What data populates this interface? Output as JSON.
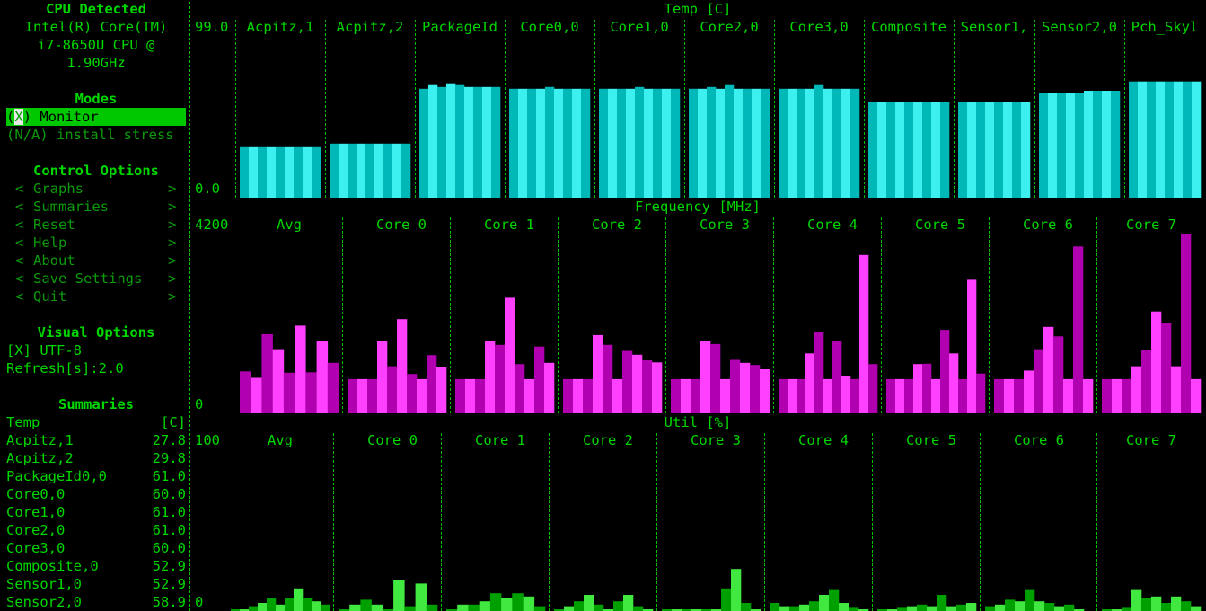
{
  "sidebar": {
    "cpu_title": "CPU Detected",
    "cpu_lines": [
      "Intel(R) Core(TM)",
      "i7-8650U CPU @",
      "1.90GHz"
    ],
    "modes_title": "Modes",
    "mode_monitor": {
      "open": "(",
      "mark": "X",
      "close": ") Monitor"
    },
    "mode_stress": "(N/A) install stress",
    "control_title": "Control Options",
    "controls": [
      {
        "label": "Graphs"
      },
      {
        "label": "Summaries"
      },
      {
        "label": "Reset"
      },
      {
        "label": "Help"
      },
      {
        "label": "About"
      },
      {
        "label": "Save Settings"
      },
      {
        "label": "Quit"
      }
    ],
    "bracket_left": "<",
    "bracket_right": ">",
    "visual_title": "Visual Options",
    "utf8_option": "[X] UTF-8",
    "refresh_option": "Refresh[s]:2.0",
    "summaries_title": "Summaries",
    "summary_header": {
      "name": "Temp",
      "unit": "[C]"
    },
    "summary_rows": [
      {
        "name": "Acpitz,1",
        "value": "27.8"
      },
      {
        "name": "Acpitz,2",
        "value": "29.8"
      },
      {
        "name": "PackageId0,0",
        "value": "61.0"
      },
      {
        "name": "Core0,0",
        "value": "60.0"
      },
      {
        "name": "Core1,0",
        "value": "61.0"
      },
      {
        "name": "Core2,0",
        "value": "61.0"
      },
      {
        "name": "Core3,0",
        "value": "60.0"
      },
      {
        "name": "Composite,0",
        "value": "52.9"
      },
      {
        "name": "Sensor1,0",
        "value": "52.9"
      },
      {
        "name": "Sensor2,0",
        "value": "58.9"
      }
    ]
  },
  "graphs": {
    "temp": {
      "title": "Temp [C]",
      "y_max": "99.0",
      "y_min": "0.0",
      "columns": [
        "Acpitz,1",
        "Acpitz,2",
        "PackageId",
        "Core0,0",
        "Core1,0",
        "Core2,0",
        "Core3,0",
        "Composite",
        "Sensor1,",
        "Sensor2,0",
        "Pch_Skyl"
      ]
    },
    "freq": {
      "title": "Frequency [MHz]",
      "y_max": "4200",
      "y_min": "0",
      "columns": [
        "Avg",
        "Core 0",
        "Core 1",
        "Core 2",
        "Core 3",
        "Core 4",
        "Core 5",
        "Core 6",
        "Core 7"
      ]
    },
    "util": {
      "title": "Util [%]",
      "y_max": "100",
      "y_min": "0",
      "columns": [
        "Avg",
        "Core 0",
        "Core 1",
        "Core 2",
        "Core 3",
        "Core 4",
        "Core 5",
        "Core 6",
        "Core 7"
      ]
    }
  },
  "chart_data": [
    {
      "type": "bar",
      "title": "Temp [C]",
      "ylabel": "Temp [C]",
      "ylim": [
        0,
        99
      ],
      "colors": [
        "#00b8b8",
        "#3cf0f0"
      ],
      "series": [
        {
          "name": "Acpitz,1",
          "values": [
            27.8,
            27.8,
            27.8,
            27.8,
            27.8,
            27.8,
            27.8,
            27.8,
            27.8
          ]
        },
        {
          "name": "Acpitz,2",
          "values": [
            29.8,
            29.8,
            29.8,
            29.8,
            29.8,
            29.8,
            29.8,
            29.8,
            29.8
          ]
        },
        {
          "name": "PackageId",
          "values": [
            60,
            62,
            61,
            63,
            62,
            61,
            61,
            61,
            61
          ]
        },
        {
          "name": "Core0,0",
          "values": [
            60,
            60,
            60,
            60,
            61,
            60,
            60,
            60,
            60
          ]
        },
        {
          "name": "Core1,0",
          "values": [
            60,
            60,
            60,
            60,
            61,
            60,
            60,
            60,
            60
          ]
        },
        {
          "name": "Core2,0",
          "values": [
            60,
            60,
            61,
            60,
            62,
            60,
            60,
            60,
            60
          ]
        },
        {
          "name": "Core3,0",
          "values": [
            60,
            60,
            60,
            60,
            62,
            60,
            60,
            60,
            60
          ]
        },
        {
          "name": "Composite",
          "values": [
            52.9,
            52.9,
            52.9,
            52.9,
            52.9,
            52.9,
            52.9,
            52.9,
            52.9
          ]
        },
        {
          "name": "Sensor1,",
          "values": [
            52.9,
            52.9,
            52.9,
            52.9,
            52.9,
            52.9,
            52.9,
            52.9
          ]
        },
        {
          "name": "Sensor2,0",
          "values": [
            57.9,
            57.9,
            57.9,
            57.9,
            57.9,
            58.9,
            58.9,
            58.9,
            58.9
          ]
        },
        {
          "name": "Pch_Skyl",
          "values": [
            64,
            64,
            64,
            64,
            64,
            64,
            64,
            64
          ]
        }
      ]
    },
    {
      "type": "bar",
      "title": "Frequency [MHz]",
      "ylabel": "Frequency [MHz]",
      "ylim": [
        0,
        4200
      ],
      "colors": [
        "#b000b0",
        "#ff40ff"
      ],
      "series": [
        {
          "name": "Avg",
          "values": [
            980,
            830,
            1850,
            1500,
            950,
            2050,
            960,
            1700,
            1180
          ]
        },
        {
          "name": "Core 0",
          "values": [
            800,
            800,
            800,
            1700,
            1100,
            2200,
            920,
            800,
            1360,
            1080
          ]
        },
        {
          "name": "Core 1",
          "values": [
            800,
            800,
            800,
            1700,
            1600,
            2700,
            1150,
            800,
            1560,
            1180
          ]
        },
        {
          "name": "Core 2",
          "values": [
            800,
            800,
            800,
            1830,
            1600,
            800,
            1460,
            1370,
            1240,
            1190
          ]
        },
        {
          "name": "Core 3",
          "values": [
            800,
            800,
            800,
            1700,
            1620,
            800,
            1250,
            1180,
            1130,
            1030
          ]
        },
        {
          "name": "Core 4",
          "values": [
            800,
            800,
            800,
            1400,
            1900,
            800,
            1700,
            870,
            800,
            3700,
            1150
          ]
        },
        {
          "name": "Core 5",
          "values": [
            800,
            800,
            800,
            1150,
            1160,
            800,
            1950,
            1400,
            800,
            3120,
            930
          ]
        },
        {
          "name": "Core 6",
          "values": [
            800,
            800,
            800,
            1000,
            1500,
            2020,
            1800,
            800,
            3900,
            800
          ]
        },
        {
          "name": "Core 7",
          "values": [
            800,
            800,
            800,
            1100,
            1470,
            2380,
            2120,
            1100,
            4200,
            800
          ]
        }
      ]
    },
    {
      "type": "bar",
      "title": "Util [%]",
      "ylabel": "Util [%]",
      "ylim": [
        0,
        100
      ],
      "colors": [
        "#00a000",
        "#40e840"
      ],
      "series": [
        {
          "name": "Avg",
          "values": [
            1,
            1,
            3,
            5,
            8,
            4,
            8,
            14,
            8,
            6,
            4
          ]
        },
        {
          "name": "Core 0",
          "values": [
            1,
            4,
            7,
            4,
            1,
            19,
            3,
            17,
            4
          ]
        },
        {
          "name": "Core 1",
          "values": [
            1,
            4,
            4,
            6,
            11,
            8,
            11,
            9,
            3
          ]
        },
        {
          "name": "Core 2",
          "values": [
            1,
            3,
            6,
            10,
            4,
            1,
            6,
            10,
            3,
            1
          ]
        },
        {
          "name": "Core 3",
          "values": [
            1,
            1,
            1,
            1,
            1,
            1,
            14,
            26,
            5,
            1
          ]
        },
        {
          "name": "Core 4",
          "values": [
            5,
            3,
            3,
            4,
            6,
            10,
            13,
            5,
            2,
            1
          ]
        },
        {
          "name": "Core 5",
          "values": [
            1,
            1,
            2,
            3,
            4,
            3,
            10,
            3,
            4,
            5
          ]
        },
        {
          "name": "Core 6",
          "values": [
            3,
            4,
            7,
            6,
            13,
            6,
            5,
            3,
            4,
            1
          ]
        },
        {
          "name": "Core 7",
          "values": [
            1,
            1,
            2,
            13,
            8,
            9,
            5,
            9,
            6,
            3
          ]
        }
      ]
    }
  ]
}
